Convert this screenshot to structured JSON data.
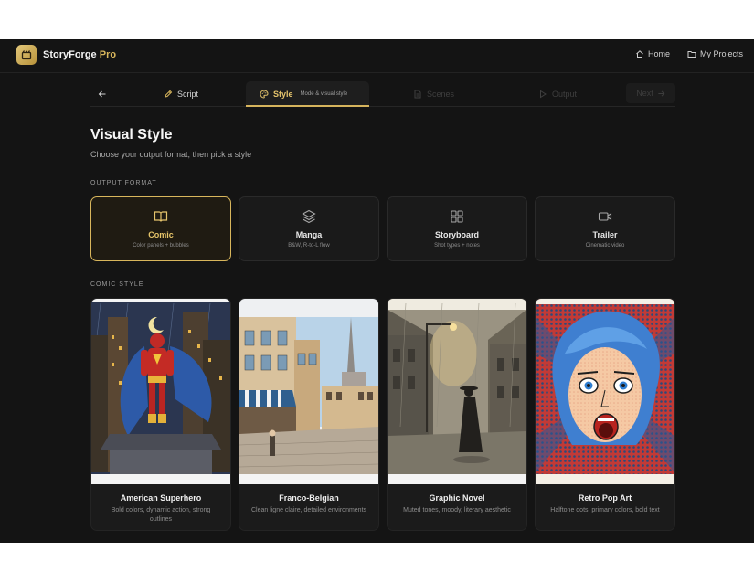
{
  "app": {
    "brand_name": "StoryForge",
    "brand_suffix": "Pro",
    "accent_color": "#d8b65c"
  },
  "header": {
    "nav": [
      {
        "label": "Home",
        "icon": "home-icon"
      },
      {
        "label": "My Projects",
        "icon": "folder-icon"
      }
    ]
  },
  "stepper": {
    "back_icon": "arrow-left-icon",
    "steps": [
      {
        "label": "Script",
        "icon": "pen-icon",
        "state": "done"
      },
      {
        "label": "Style",
        "sub": "Mode & visual style",
        "icon": "palette-icon",
        "state": "active"
      },
      {
        "label": "Scenes",
        "icon": "file-icon",
        "state": "disabled"
      },
      {
        "label": "Output",
        "icon": "play-icon",
        "state": "disabled"
      }
    ],
    "next_label": "Next"
  },
  "page": {
    "title": "Visual Style",
    "subtitle": "Choose your output format, then pick a style"
  },
  "output_format": {
    "label": "OUTPUT FORMAT",
    "options": [
      {
        "name": "Comic",
        "desc": "Color panels + bubbles",
        "icon": "book-open-icon",
        "selected": true
      },
      {
        "name": "Manga",
        "desc": "B&W, R-to-L flow",
        "icon": "layers-icon",
        "selected": false
      },
      {
        "name": "Storyboard",
        "desc": "Shot types + notes",
        "icon": "grid-icon",
        "selected": false
      },
      {
        "name": "Trailer",
        "desc": "Cinematic video",
        "icon": "video-icon",
        "selected": false
      }
    ]
  },
  "comic_style": {
    "label": "COMIC STYLE",
    "options": [
      {
        "name": "American Superhero",
        "desc": "Bold colors, dynamic action, strong outlines"
      },
      {
        "name": "Franco-Belgian",
        "desc": "Clean ligne claire, detailed environments"
      },
      {
        "name": "Graphic Novel",
        "desc": "Muted tones, moody, literary aesthetic"
      },
      {
        "name": "Retro Pop Art",
        "desc": "Halftone dots, primary colors, bold text"
      }
    ]
  }
}
